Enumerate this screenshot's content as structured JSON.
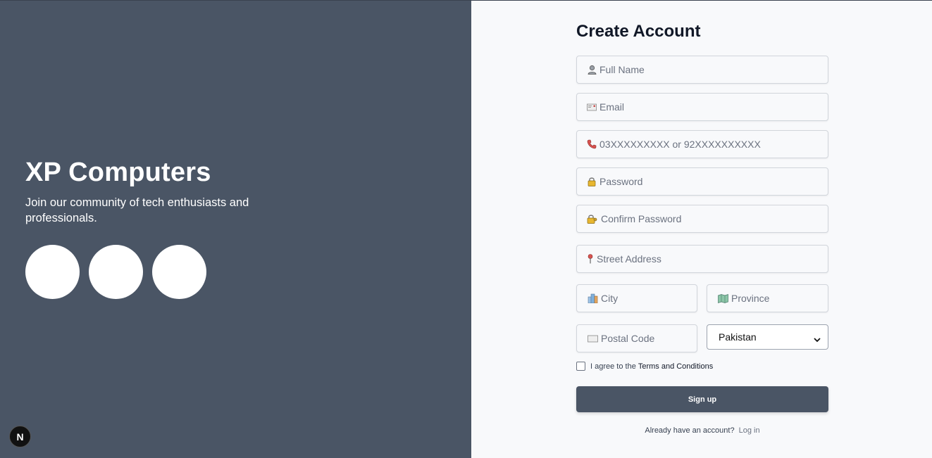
{
  "brand": {
    "title": "XP Computers",
    "tagline": "Join our community of tech enthusiasts and professionals."
  },
  "badge": {
    "letter": "N"
  },
  "form": {
    "title": "Create Account",
    "fields": {
      "full_name": {
        "placeholder": "Full Name",
        "icon": "person-icon"
      },
      "email": {
        "placeholder": "Email",
        "icon": "envelope-icon"
      },
      "phone": {
        "placeholder": "03XXXXXXXXX or 92XXXXXXXXXX",
        "icon": "phone-icon"
      },
      "password": {
        "placeholder": "Password",
        "icon": "lock-icon"
      },
      "confirm_password": {
        "placeholder": "Confirm Password",
        "icon": "lock-key-icon"
      },
      "street": {
        "placeholder": "Street Address",
        "icon": "pin-icon"
      },
      "city": {
        "placeholder": "City",
        "icon": "city-icon"
      },
      "province": {
        "placeholder": "Province",
        "icon": "map-icon"
      },
      "postal": {
        "placeholder": "Postal Code",
        "icon": "mailbox-icon"
      }
    },
    "country": {
      "selected": "Pakistan"
    },
    "terms": {
      "prefix": "I agree to the",
      "link": "Terms and Conditions"
    },
    "signup_label": "Sign up",
    "login": {
      "prefix": "Already have an account?",
      "link": "Log in"
    }
  },
  "colors": {
    "left_panel": "#4a5565",
    "right_panel": "#f8f9fb",
    "button": "#4a5565"
  }
}
